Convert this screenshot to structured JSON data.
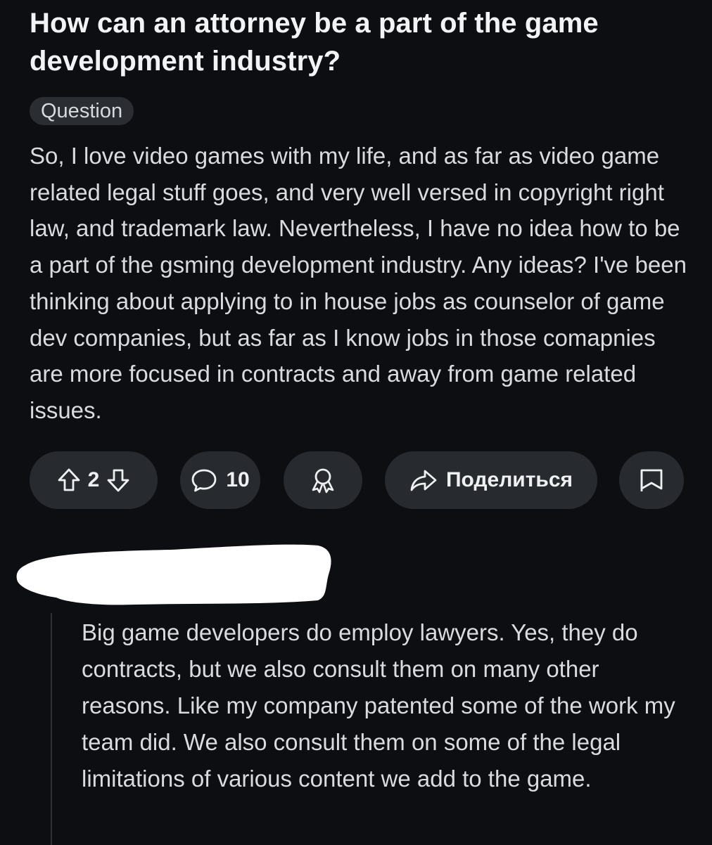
{
  "post": {
    "title": "How can an attorney be a part of the game development industry?",
    "flair": "Question",
    "body": "So, I love video games with my life, and as far as video game related legal stuff goes, and very well versed in copyright right law, and trademark law. Nevertheless, I have no idea how to be a part of the gsming development industry. Any ideas? I've been thinking about applying to in house jobs as counselor of game dev companies, but as far as I know jobs in those comapnies are more focused in contracts and away from game related issues."
  },
  "actions": {
    "vote_count": "2",
    "comment_count": "10",
    "share_label": "Поделиться",
    "icons": {
      "upvote": "arrow-up-icon",
      "downvote": "arrow-down-icon",
      "comments": "speech-bubble-icon",
      "award": "award-ribbon-icon",
      "share": "share-arrow-icon",
      "save": "bookmark-icon"
    }
  },
  "comment": {
    "author_redacted": true,
    "body": "Big game developers do employ lawyers. Yes, they do contracts, but we also consult them on many other reasons. Like my company patented some of the work my team did. We also consult them on some of the legal limitations of various content we add to the game."
  },
  "colors": {
    "background": "#0c0e11",
    "pill": "#272a2e",
    "text": "#e8eaed"
  }
}
